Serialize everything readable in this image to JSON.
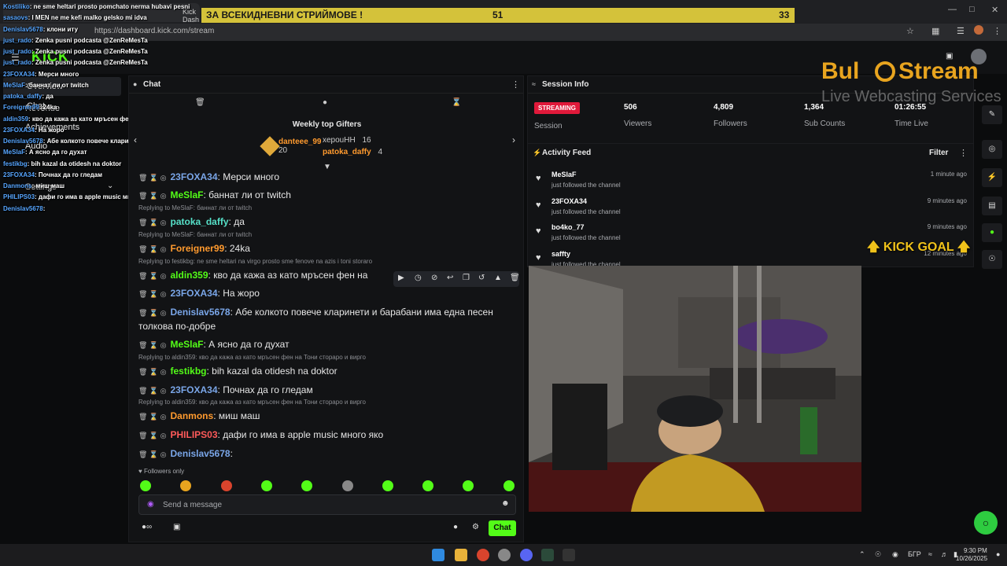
{
  "browser": {
    "url": "https://dashboard.kick.com/stream",
    "tabs": [
      "Kick Dash"
    ]
  },
  "banner": {
    "text": "ЗА ВСЕКИДНЕВНИ СТРИЙМОВЕ !",
    "count_a": "51",
    "count_b": "33"
  },
  "logo": {
    "brand": "Bul",
    "brand2": "Stream",
    "tagline": "Live Webcasting Services",
    "kick_text": "KICK"
  },
  "sidebar": {
    "items": [
      "Overview",
      "Chat",
      "Revenue",
      "Achievements",
      "Audio",
      "Settings"
    ]
  },
  "overlay_chat": [
    {
      "user": "Kostiliko",
      "text": ": ne sme heltari prosto pomchato nerma hubavi pesni"
    },
    {
      "user": "sasaovs",
      "text": ": I MEN ne me kefi malko gelsko mi idva"
    },
    {
      "user": "Denislav5678",
      "text": ": клони иту"
    },
    {
      "user": "just_rado",
      "text": ": Zenka pusni podcasta @ZenReMesTa"
    },
    {
      "user": "just_rado",
      "text": ": Zenka pusni podcasta @ZenReMesTa"
    },
    {
      "user": "just_rado",
      "text": ": Zenka pusni podcasta @ZenReMesTa"
    },
    {
      "user": "23FOXA34",
      "text": ": Мерси много"
    },
    {
      "user": "MeSlaF",
      "text": ": баннат ли от twitch"
    },
    {
      "user": "patoka_daffy",
      "text": ": да"
    },
    {
      "user": "Foreigner99",
      "text": ": 24ka"
    },
    {
      "user": "aldin359",
      "text": ": кво да кажа аз като мръсен фен на Тони сторaро и вирго"
    },
    {
      "user": "23FOXA34",
      "text": ": На жоро"
    },
    {
      "user": "Denislav5678",
      "text": ": Абе колкото повече кларинети и барабани има една песен толкова по-добре"
    },
    {
      "user": "MeSlaF",
      "text": ": А ясно да го духат"
    },
    {
      "user": "festikbg",
      "text": ": bih kazal da otidesh na doktor"
    },
    {
      "user": "23FOXA34",
      "text": ": Почнах да го гледам"
    },
    {
      "user": "Danmons",
      "text": ": миш маш"
    },
    {
      "user": "PHILIPS03",
      "text": ": дафи го има в apple music много яко"
    },
    {
      "user": "Denislav5678",
      "text": ": "
    }
  ],
  "chat": {
    "title": "Chat",
    "gifters_title": "Weekly top Gifters",
    "gifters": [
      {
        "name": "danteee_99",
        "count": "20"
      },
      {
        "name": "xepouHH",
        "count": "16"
      },
      {
        "name": "patoka_daffy",
        "count": "4"
      }
    ],
    "messages": [
      {
        "reply": "",
        "user": "23FOXA34",
        "text": ": Мерси много"
      },
      {
        "reply": "",
        "user": "MeSlaF",
        "text": ": баннат ли от twitch"
      },
      {
        "reply": "Replying to MeSlaF: баннат ли от twitch",
        "user": "patoka_daffy",
        "text": ": да"
      },
      {
        "reply": "Replying to MeSlaF: баннат ли от twitch",
        "user": "Foreigner99",
        "text": ": 24ka"
      },
      {
        "reply": "Replying to festikbg: ne sme heltari na virgo prosto sme fenove na azis i toni storaro",
        "user": "aldin359",
        "text": ": кво да кажа аз като мръсен фен на"
      },
      {
        "reply": "",
        "user": "23FOXA34",
        "text": ": На жоро"
      },
      {
        "reply": "",
        "user": "Denislav5678",
        "text": ": Абе колкото повече кларинети и барабани има една песен толкова по-добре"
      },
      {
        "reply": "",
        "user": "MeSlaF",
        "text": ": А ясно да го духат"
      },
      {
        "reply": "Replying to aldin359: кво да кажа аз като мръсен фен на Тони сторaро и вирго",
        "user": "festikbg",
        "text": ": bih kazal da otidesh na doktor"
      },
      {
        "reply": "",
        "user": "23FOXA34",
        "text": ": Почнах да го гледам"
      },
      {
        "reply": "Replying to aldin359: кво да кажа аз като мръсен фен на Тони сторaро и вирго",
        "user": "Danmons",
        "text": ": миш маш"
      },
      {
        "reply": "",
        "user": "PHILIPS03",
        "text": ": дафи го има в apple music много яко"
      },
      {
        "reply": "",
        "user": "Denislav5678",
        "text": ":"
      }
    ],
    "followers_only": "Followers only",
    "input_placeholder": "Send a message",
    "send_label": "Chat"
  },
  "session": {
    "title": "Session Info",
    "status": "STREAMING",
    "status_label": "Session",
    "stats": [
      {
        "value": "506",
        "label": "Viewers"
      },
      {
        "value": "4,809",
        "label": "Followers"
      },
      {
        "value": "1,364",
        "label": "Sub Counts"
      },
      {
        "value": "01:26:55",
        "label": "Time Live"
      }
    ]
  },
  "feed": {
    "title": "Activity Feed",
    "filter_label": "Filter",
    "items": [
      {
        "name": "MeSlaF",
        "desc": "just followed the channel",
        "time": "1 minute ago"
      },
      {
        "name": "23FOXA34",
        "desc": "just followed the channel",
        "time": "9 minutes ago"
      },
      {
        "name": "bo4ko_77",
        "desc": "just followed the channel",
        "time": "9 minutes ago"
      },
      {
        "name": "saffty",
        "desc": "just followed the channel",
        "time": "12 minutes ago"
      }
    ]
  },
  "kick_goal": "KICK GOAL",
  "taskbar": {
    "lang": "БГР",
    "time": "9:30 PM",
    "date": "10/26/2025"
  }
}
